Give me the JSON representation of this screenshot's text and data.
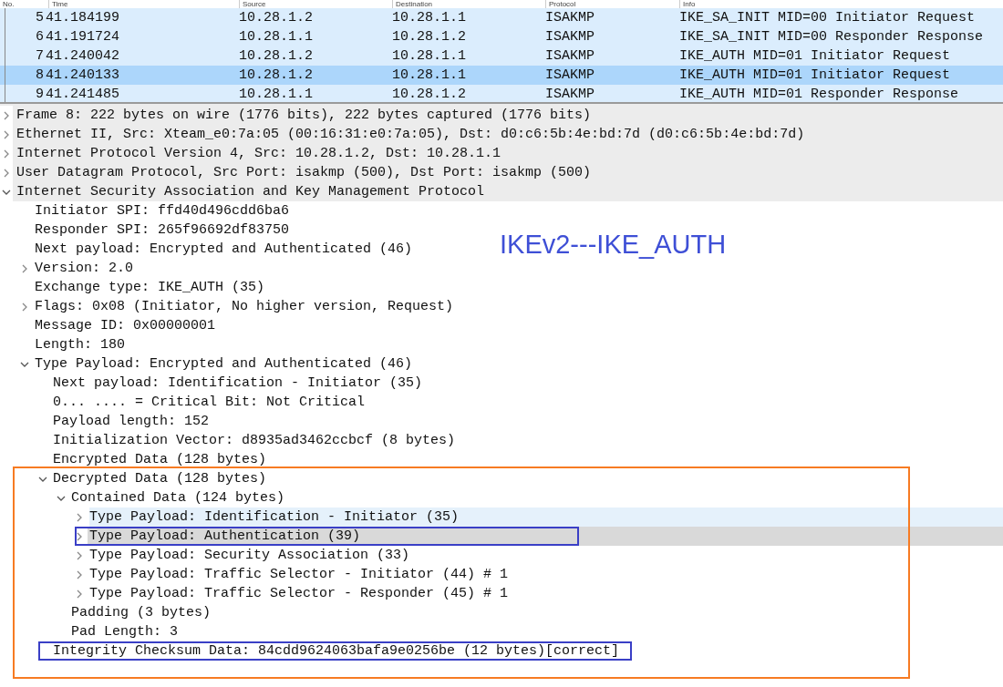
{
  "packet_list": {
    "columns": [
      "No.",
      "Time",
      "Source",
      "Destination",
      "Protocol",
      "Info"
    ],
    "rows": [
      {
        "no": "5",
        "time": "41.184199",
        "source": "10.28.1.2",
        "destination": "10.28.1.1",
        "protocol": "ISAKMP",
        "info": "IKE_SA_INIT MID=00 Initiator Request",
        "selected": false
      },
      {
        "no": "6",
        "time": "41.191724",
        "source": "10.28.1.1",
        "destination": "10.28.1.2",
        "protocol": "ISAKMP",
        "info": "IKE_SA_INIT MID=00 Responder Response",
        "selected": false
      },
      {
        "no": "7",
        "time": "41.240042",
        "source": "10.28.1.2",
        "destination": "10.28.1.1",
        "protocol": "ISAKMP",
        "info": "IKE_AUTH MID=01 Initiator Request",
        "selected": false
      },
      {
        "no": "8",
        "time": "41.240133",
        "source": "10.28.1.2",
        "destination": "10.28.1.1",
        "protocol": "ISAKMP",
        "info": "IKE_AUTH MID=01 Initiator Request",
        "selected": true
      },
      {
        "no": "9",
        "time": "41.241485",
        "source": "10.28.1.1",
        "destination": "10.28.1.2",
        "protocol": "ISAKMP",
        "info": "IKE_AUTH MID=01 Responder Response",
        "selected": false
      }
    ]
  },
  "annotation_title": "IKEv2---IKE_AUTH",
  "details": [
    {
      "label": "Frame 8: 222 bytes on wire (1776 bits), 222 bytes captured (1776 bits)",
      "kind": "branch",
      "expanded": false,
      "selected": false,
      "hovered": false
    },
    {
      "label": "Ethernet II, Src: Xteam_e0:7a:05 (00:16:31:e0:7a:05), Dst: d0:c6:5b:4e:bd:7d (d0:c6:5b:4e:bd:7d)",
      "kind": "branch",
      "expanded": false,
      "selected": false,
      "hovered": false
    },
    {
      "label": "Internet Protocol Version 4, Src: 10.28.1.2, Dst: 10.28.1.1",
      "kind": "branch",
      "expanded": false,
      "selected": false,
      "hovered": false
    },
    {
      "label": "User Datagram Protocol, Src Port: isakmp (500), Dst Port: isakmp (500)",
      "kind": "branch",
      "expanded": false,
      "selected": false,
      "hovered": false
    },
    {
      "label": "Internet Security Association and Key Management Protocol",
      "kind": "branch",
      "expanded": true,
      "selected": false,
      "hovered": false,
      "children": [
        {
          "label": "Initiator SPI: ffd40d496cdd6ba6",
          "kind": "leaf",
          "selected": false,
          "hovered": false
        },
        {
          "label": "Responder SPI: 265f96692df83750",
          "kind": "leaf",
          "selected": false,
          "hovered": false
        },
        {
          "label": "Next payload: Encrypted and Authenticated (46)",
          "kind": "leaf",
          "selected": false,
          "hovered": false
        },
        {
          "label": "Version: 2.0",
          "kind": "branch",
          "expanded": false,
          "selected": false,
          "hovered": false
        },
        {
          "label": "Exchange type: IKE_AUTH (35)",
          "kind": "leaf",
          "selected": false,
          "hovered": false
        },
        {
          "label": "Flags: 0x08 (Initiator, No higher version, Request)",
          "kind": "branch",
          "expanded": false,
          "selected": false,
          "hovered": false
        },
        {
          "label": "Message ID: 0x00000001",
          "kind": "leaf",
          "selected": false,
          "hovered": false
        },
        {
          "label": "Length: 180",
          "kind": "leaf",
          "selected": false,
          "hovered": false
        },
        {
          "label": "Type Payload: Encrypted and Authenticated (46)",
          "kind": "branch",
          "expanded": true,
          "selected": false,
          "hovered": false,
          "children": [
            {
              "label": "Next payload: Identification - Initiator (35)",
              "kind": "leaf",
              "selected": false,
              "hovered": false
            },
            {
              "label": "0... .... = Critical Bit: Not Critical",
              "kind": "leaf",
              "selected": false,
              "hovered": false
            },
            {
              "label": "Payload length: 152",
              "kind": "leaf",
              "selected": false,
              "hovered": false
            },
            {
              "label": "Initialization Vector: d8935ad3462ccbcf (8 bytes)",
              "kind": "leaf",
              "selected": false,
              "hovered": false
            },
            {
              "label": "Encrypted Data (128 bytes)",
              "kind": "leaf",
              "selected": false,
              "hovered": false
            },
            {
              "label": "Decrypted Data (128 bytes)",
              "kind": "branch",
              "expanded": true,
              "selected": false,
              "hovered": false,
              "framed": true,
              "children": [
                {
                  "label": "Contained Data (124 bytes)",
                  "kind": "branch",
                  "expanded": true,
                  "selected": false,
                  "hovered": false,
                  "children": [
                    {
                      "label": "Type Payload: Identification - Initiator (35)",
                      "kind": "branch",
                      "expanded": false,
                      "selected": false,
                      "hovered": true
                    },
                    {
                      "label": "Type Payload: Authentication (39)",
                      "kind": "branch",
                      "expanded": false,
                      "selected": true,
                      "hovered": false,
                      "boxed": true
                    },
                    {
                      "label": "Type Payload: Security Association (33)",
                      "kind": "branch",
                      "expanded": false,
                      "selected": false,
                      "hovered": false
                    },
                    {
                      "label": "Type Payload: Traffic Selector - Initiator (44) # 1",
                      "kind": "branch",
                      "expanded": false,
                      "selected": false,
                      "hovered": false
                    },
                    {
                      "label": "Type Payload: Traffic Selector - Responder (45) # 1",
                      "kind": "branch",
                      "expanded": false,
                      "selected": false,
                      "hovered": false
                    }
                  ]
                },
                {
                  "label": "Padding (3 bytes)",
                  "kind": "leaf",
                  "selected": false,
                  "hovered": false
                },
                {
                  "label": "Pad Length: 3",
                  "kind": "leaf",
                  "selected": false,
                  "hovered": false
                }
              ]
            },
            {
              "label": "Integrity Checksum Data: 84cdd9624063bafa9e0256be (12 bytes)[correct]",
              "kind": "leaf",
              "selected": false,
              "hovered": false,
              "framed": true,
              "boxed": true
            }
          ]
        }
      ]
    }
  ]
}
